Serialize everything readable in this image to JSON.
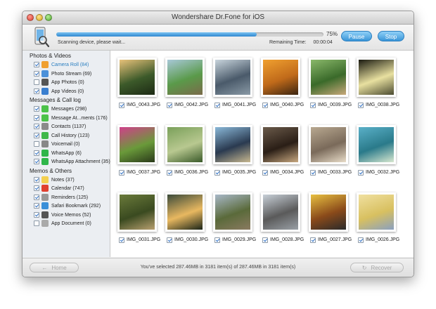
{
  "window": {
    "title": "Wondershare Dr.Fone for iOS"
  },
  "toolbar": {
    "progress_percent": 75,
    "progress_text": "75%",
    "status": "Scanning device, please wait...",
    "remaining_label": "Remaining Time:",
    "remaining_value": "00:00:04",
    "pause_label": "Pause",
    "stop_label": "Stop"
  },
  "sidebar": {
    "sections": [
      {
        "title": "Photos & Videos",
        "items": [
          {
            "label": "Camera Roll (84)",
            "checked": true,
            "active": true,
            "icon": "camera-roll-icon",
            "color": "#f0a030"
          },
          {
            "label": "Photo Stream (69)",
            "checked": true,
            "active": false,
            "icon": "photo-stream-icon",
            "color": "#4a90d9"
          },
          {
            "label": "App Photos (0)",
            "checked": false,
            "active": false,
            "icon": "app-photos-icon",
            "color": "#555555"
          },
          {
            "label": "App Videos (0)",
            "checked": true,
            "active": false,
            "icon": "app-videos-icon",
            "color": "#3a7fd0"
          }
        ]
      },
      {
        "title": "Messages & Call log",
        "items": [
          {
            "label": "Messages (298)",
            "checked": true,
            "active": false,
            "icon": "messages-icon",
            "color": "#4cc24a"
          },
          {
            "label": "Message At...ments (176)",
            "checked": true,
            "active": false,
            "icon": "message-attachments-icon",
            "color": "#4cc24a"
          },
          {
            "label": "Contacts (1137)",
            "checked": true,
            "active": false,
            "icon": "contacts-icon",
            "color": "#8a8a8a"
          },
          {
            "label": "Call History (123)",
            "checked": true,
            "active": false,
            "icon": "call-history-icon",
            "color": "#3fb84a"
          },
          {
            "label": "Voicemail (0)",
            "checked": false,
            "active": false,
            "icon": "voicemail-icon",
            "color": "#888888"
          },
          {
            "label": "WhatsApp (6)",
            "checked": true,
            "active": false,
            "icon": "whatsapp-icon",
            "color": "#2fb64a"
          },
          {
            "label": "WhatsApp Attachment (35)",
            "checked": true,
            "active": false,
            "icon": "whatsapp-attachment-icon",
            "color": "#2fb64a"
          }
        ]
      },
      {
        "title": "Memos & Others",
        "items": [
          {
            "label": "Notes (37)",
            "checked": true,
            "active": false,
            "icon": "notes-icon",
            "color": "#f4d050"
          },
          {
            "label": "Calendar (747)",
            "checked": true,
            "active": false,
            "icon": "calendar-icon",
            "color": "#e04030"
          },
          {
            "label": "Reminders (125)",
            "checked": true,
            "active": false,
            "icon": "reminders-icon",
            "color": "#999999"
          },
          {
            "label": "Safari Bookmark (292)",
            "checked": true,
            "active": false,
            "icon": "safari-bookmark-icon",
            "color": "#3a8fd8"
          },
          {
            "label": "Voice Memos (52)",
            "checked": true,
            "active": false,
            "icon": "voice-memos-icon",
            "color": "#555555"
          },
          {
            "label": "App Document (0)",
            "checked": false,
            "active": false,
            "icon": "app-document-icon",
            "color": "#aaaaaa"
          }
        ]
      }
    ]
  },
  "photos": [
    {
      "name": "IMG_0043.JPG",
      "checked": true,
      "palette": [
        "#e8c27a",
        "#3c5a2a",
        "#1d2a14"
      ]
    },
    {
      "name": "IMG_0042.JPG",
      "checked": true,
      "palette": [
        "#a8c8d8",
        "#5a9a4a",
        "#7a6a4a"
      ]
    },
    {
      "name": "IMG_0041.JPG",
      "checked": true,
      "palette": [
        "#c8d4dc",
        "#4a5a6a",
        "#8a9aa6"
      ]
    },
    {
      "name": "IMG_0040.JPG",
      "checked": true,
      "palette": [
        "#f0a030",
        "#c06a1a",
        "#3a2410"
      ]
    },
    {
      "name": "IMG_0039.JPG",
      "checked": true,
      "palette": [
        "#8ab86a",
        "#3a6a2a",
        "#c8a87a"
      ]
    },
    {
      "name": "IMG_0038.JPG",
      "checked": true,
      "palette": [
        "#1a1a10",
        "#e8e0a0",
        "#4a4a30"
      ]
    },
    {
      "name": "IMG_0037.JPG",
      "checked": true,
      "palette": [
        "#d0408a",
        "#6a9a3a",
        "#2a3a1a"
      ]
    },
    {
      "name": "IMG_0036.JPG",
      "checked": true,
      "palette": [
        "#7aa05a",
        "#b8c890",
        "#3a5a2a"
      ]
    },
    {
      "name": "IMG_0035.JPG",
      "checked": true,
      "palette": [
        "#8ab8d8",
        "#2a3a50",
        "#c8b890"
      ]
    },
    {
      "name": "IMG_0034.JPG",
      "checked": true,
      "palette": [
        "#6a5a4a",
        "#2a1e16",
        "#c8a880"
      ]
    },
    {
      "name": "IMG_0033.JPG",
      "checked": true,
      "palette": [
        "#b8a890",
        "#7a6a5a",
        "#e8dcc8"
      ]
    },
    {
      "name": "IMG_0032.JPG",
      "checked": true,
      "palette": [
        "#5ab0c8",
        "#2a7a8a",
        "#d8e8d0"
      ]
    },
    {
      "name": "IMG_0031.JPG",
      "checked": true,
      "palette": [
        "#6a7a3a",
        "#3a4a20",
        "#b8a070"
      ]
    },
    {
      "name": "IMG_0030.JPG",
      "checked": true,
      "palette": [
        "#3a4a3a",
        "#e8b860",
        "#1a2418"
      ]
    },
    {
      "name": "IMG_0029.JPG",
      "checked": true,
      "palette": [
        "#a8b8c8",
        "#5a6a3a",
        "#8a7a60"
      ]
    },
    {
      "name": "IMG_0028.JPG",
      "checked": true,
      "palette": [
        "#c8d0d8",
        "#5a5a5a",
        "#9aa0a6"
      ]
    },
    {
      "name": "IMG_0027.JPG",
      "checked": true,
      "palette": [
        "#e8c040",
        "#8a4a1a",
        "#2a2a2a"
      ]
    },
    {
      "name": "IMG_0026.JPG",
      "checked": true,
      "palette": [
        "#f0e0a0",
        "#d8c060",
        "#8aa0c0"
      ]
    }
  ],
  "footer": {
    "home_label": "Home",
    "recover_label": "Recover",
    "summary": "You've selected 287.46MB in 3181 item(s) of 287.46MB in 3181 item(s)"
  },
  "colors": {
    "accent": "#3a96d8",
    "active_text": "#2a7ec0"
  }
}
